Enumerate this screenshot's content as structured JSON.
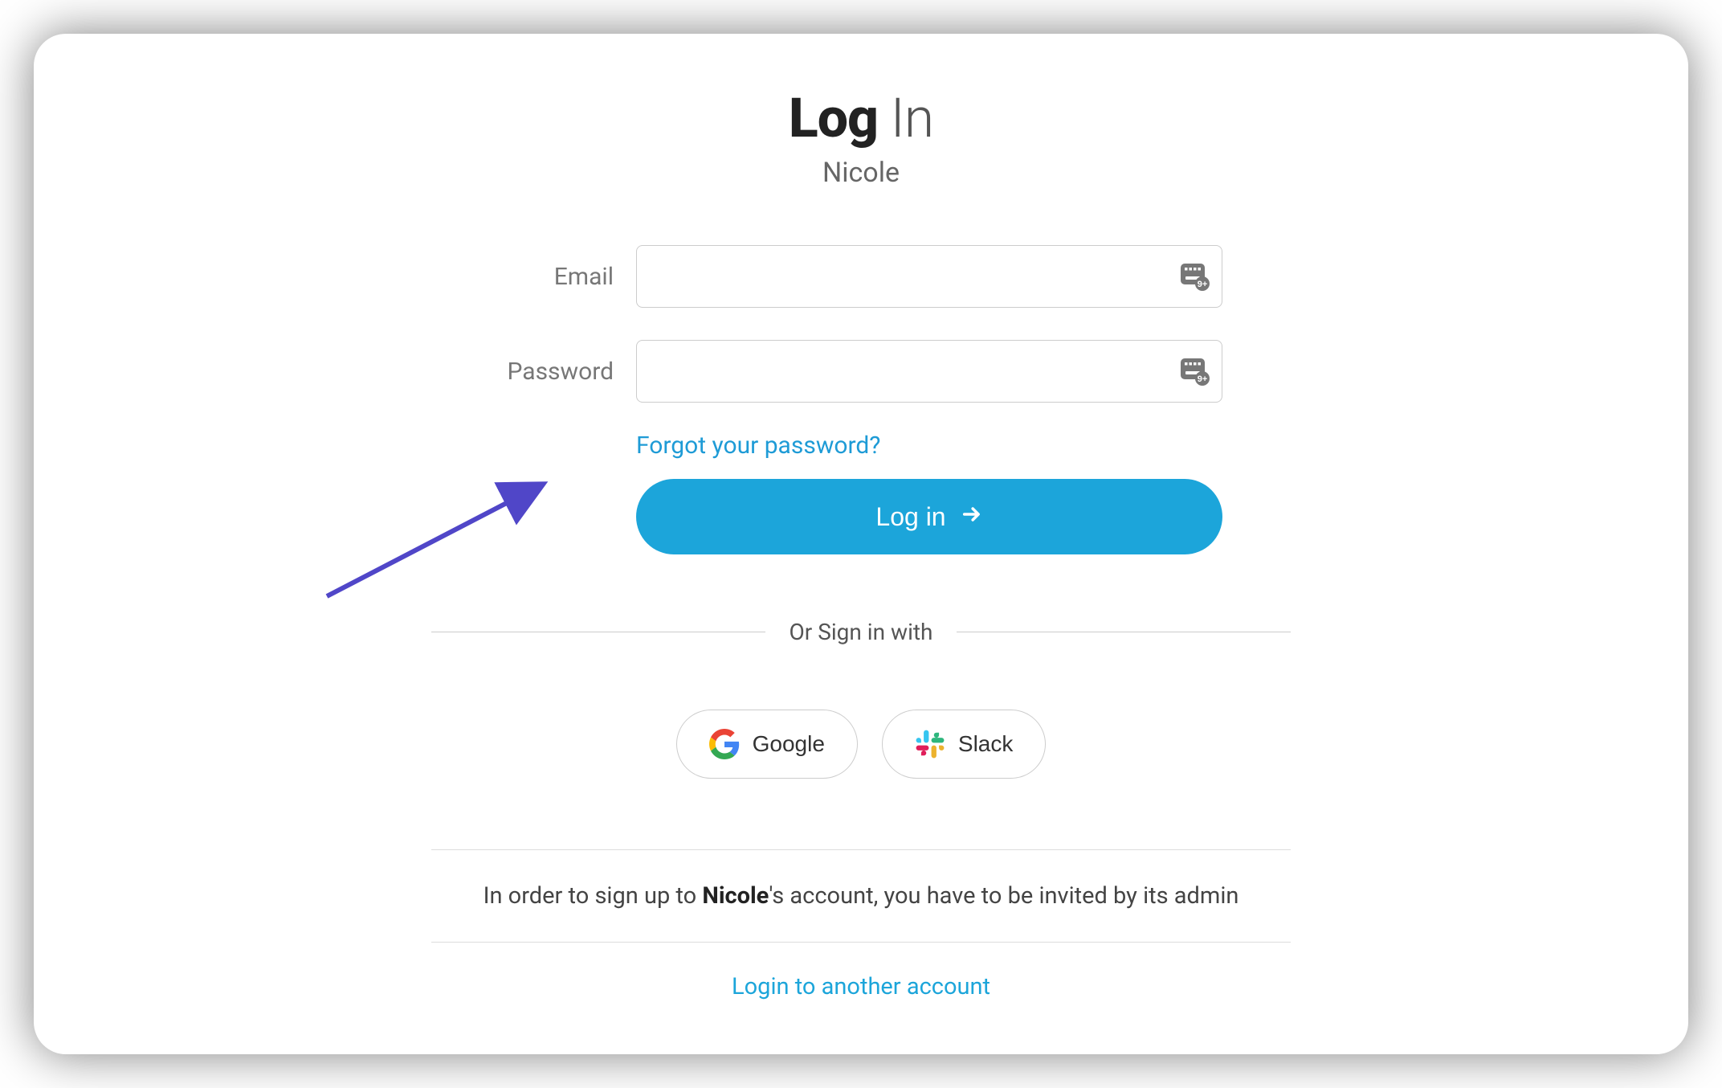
{
  "title": {
    "bold": "Log",
    "light": " In"
  },
  "subtitle": "Nicole",
  "form": {
    "email_label": "Email",
    "email_value": "",
    "password_label": "Password",
    "password_value": "",
    "forgot_label": "Forgot your password?",
    "login_button_label": "Log in"
  },
  "divider_text": "Or Sign in with",
  "sso": {
    "google_label": "Google",
    "slack_label": "Slack"
  },
  "footer": {
    "invite_prefix": "In order to sign up to ",
    "invite_account": "Nicole",
    "invite_suffix": "'s account, you have to be invited by its admin",
    "another_account_label": "Login to another account"
  },
  "colors": {
    "primary": "#1ca5da",
    "link": "#1e9bd6",
    "annotation": "#5046c8"
  }
}
